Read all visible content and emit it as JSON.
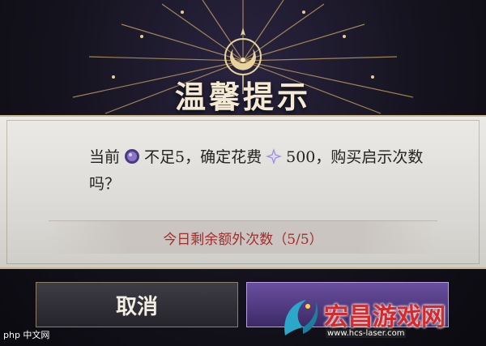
{
  "dialog": {
    "title": "温馨提示",
    "message_prefix": "当前",
    "message_mid": "不足5，确定花费",
    "message_cost": "500，购买启示次数",
    "message_line2": "吗？",
    "notice": "今日剩余额外次数（5/5）"
  },
  "buttons": {
    "cancel_label": "取消"
  },
  "icons": {
    "currency_icon": "purple-orb-icon",
    "cost_icon": "star-crystal-icon",
    "crest_icon": "crescent-moon-icon"
  },
  "watermark": {
    "left_text": "php 中文网",
    "site_name": "宏昌游戏网",
    "site_url": "www.hcs-laser.com"
  },
  "colors": {
    "title": "#f4ead3",
    "notice": "#a82a2a",
    "confirm_button": "#5a3f8f",
    "watermark": "#d62a2a"
  }
}
